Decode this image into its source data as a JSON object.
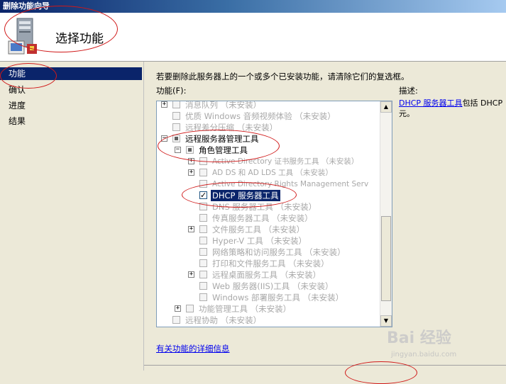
{
  "window": {
    "title": "删除功能向导"
  },
  "header": {
    "title": "选择功能"
  },
  "sidebar": {
    "steps": [
      {
        "label": "功能"
      },
      {
        "label": "确认"
      },
      {
        "label": "进度"
      },
      {
        "label": "结果"
      }
    ]
  },
  "main": {
    "instruction": "若要删除此服务器上的一个或多个已安装功能，请清除它们的复选框。",
    "features_label": "功能(F):",
    "description_label": "描述:",
    "description_link": "DHCP 服务器工具",
    "description_rest": "包括 DHCP",
    "description_rest2": "元。",
    "more_info_link": "有关功能的详细信息",
    "tree": [
      {
        "text": "消息队列  （未安装）"
      },
      {
        "text": "优质 Windows 音频视频体验  （未安装）"
      },
      {
        "text": "远程差分压缩  （未安装）"
      },
      {
        "text": "远程服务器管理工具"
      },
      {
        "text": "角色管理工具"
      },
      {
        "text": "Active Directory 证书服务工具  （未安装）"
      },
      {
        "text": "AD DS 和 AD LDS 工具  （未安装）"
      },
      {
        "text": "Active Directory Rights Management Serv"
      },
      {
        "text": "DHCP 服务器工具"
      },
      {
        "text": "DNS 服务器工具  （未安装）"
      },
      {
        "text": "传真服务器工具  （未安装）"
      },
      {
        "text": "文件服务工具  （未安装）"
      },
      {
        "text": "Hyper-V 工具  （未安装）"
      },
      {
        "text": "网络策略和访问服务工具  （未安装）"
      },
      {
        "text": "打印和文件服务工具  （未安装）"
      },
      {
        "text": "远程桌面服务工具  （未安装）"
      },
      {
        "text": "Web 服务器(IIS)工具  （未安装）"
      },
      {
        "text": "Windows 部署服务工具  （未安装）"
      },
      {
        "text": "功能管理工具  （未安装）"
      },
      {
        "text": "远程协助  （未安装）"
      }
    ]
  },
  "watermark": {
    "brand": "Bai 经验",
    "url": "jingyan.baidu.com"
  },
  "colors": {
    "selection": "#0a246a",
    "annotation": "#d01818",
    "link": "#0000ee"
  }
}
